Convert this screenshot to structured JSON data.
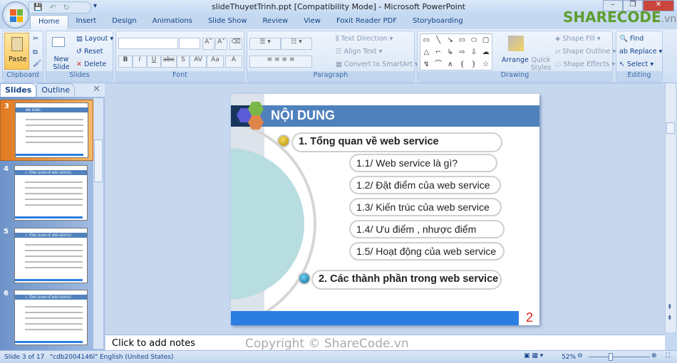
{
  "window": {
    "title": "slideThuyetTrinh.ppt [Compatibility Mode] - Microsoft PowerPoint",
    "minimize": "–",
    "restore": "❐",
    "close": "✕"
  },
  "quick_access": {
    "save": "💾",
    "undo": "↶",
    "redo": "↻",
    "more": "▾"
  },
  "tabs": [
    "Home",
    "Insert",
    "Design",
    "Animations",
    "Slide Show",
    "Review",
    "View",
    "Foxit Reader PDF",
    "Storyboarding"
  ],
  "active_tab": "Home",
  "watermark": {
    "brand": "SHARECODE",
    "suffix": ".vn"
  },
  "ribbon": {
    "clipboard": {
      "label": "Clipboard",
      "paste": "Paste"
    },
    "slides": {
      "label": "Slides",
      "new_slide": "New Slide",
      "layout": "Layout",
      "reset": "Reset",
      "delete": "Delete"
    },
    "font": {
      "label": "Font",
      "bold": "B",
      "italic": "I",
      "underline": "U",
      "strike": "abc",
      "shadow": "S",
      "spacing": "AV",
      "case": "Aa",
      "color": "A",
      "grow": "A˄",
      "shrink": "A˅"
    },
    "paragraph": {
      "label": "Paragraph",
      "text_direction": "Text Direction",
      "align_text": "Align Text",
      "convert_smartart": "Convert to SmartArt"
    },
    "drawing": {
      "label": "Drawing",
      "arrange": "Arrange",
      "quick_styles": "Quick Styles",
      "shape_fill": "Shape Fill",
      "shape_outline": "Shape Outline",
      "shape_effects": "Shape Effects",
      "shapes": [
        "▭",
        "╲",
        "↘",
        "▭",
        "⬭",
        "▢",
        "△",
        "⌐",
        "↳",
        "⇨",
        "⇩",
        "☁",
        "↯",
        "⌒",
        "∧",
        "{",
        "}",
        "☆"
      ]
    },
    "editing": {
      "label": "Editing",
      "find": "Find",
      "replace": "Replace",
      "select": "Select"
    }
  },
  "panel": {
    "tab_slides": "Slides",
    "tab_outline": "Outline",
    "close": "✕",
    "thumbs": [
      {
        "num": "3",
        "title": "NỘI DUNG",
        "selected": true
      },
      {
        "num": "4",
        "title": "1. TỔNG QUAN VỀ WEB SERVICE",
        "selected": false
      },
      {
        "num": "5",
        "title": "1. TỔNG QUAN VỀ WEB SERVICE",
        "selected": false
      },
      {
        "num": "6",
        "title": "1. TỔNG QUAN VỀ WEB SERVICE",
        "selected": false
      }
    ]
  },
  "slide": {
    "title": "NỘI DUNG",
    "page_number": "2",
    "item1": "1. Tổng quan về web service",
    "subitems": [
      "1.1/ Web service là gì?",
      "1.2/ Đặt điểm của web service",
      "1.3/ Kiến trúc của web service",
      "1.4/ Ưu điểm , nhược điểm",
      "1.5/ Hoạt động của web service"
    ],
    "item2": "2. Các thành phần trong web service",
    "colors": {
      "header": "#4f81bd",
      "footer": "#2b7de1",
      "circle": "#b7dde0",
      "page_number": "#e02020"
    }
  },
  "notes": {
    "placeholder": "Click to add notes"
  },
  "copyright": "Copyright © ShareCode.vn",
  "status": {
    "slide": "Slide 3 of 17",
    "theme": "\"cdb2004146l\"",
    "language": "English (United States)",
    "zoom": "52%",
    "zoom_percent": 52
  }
}
